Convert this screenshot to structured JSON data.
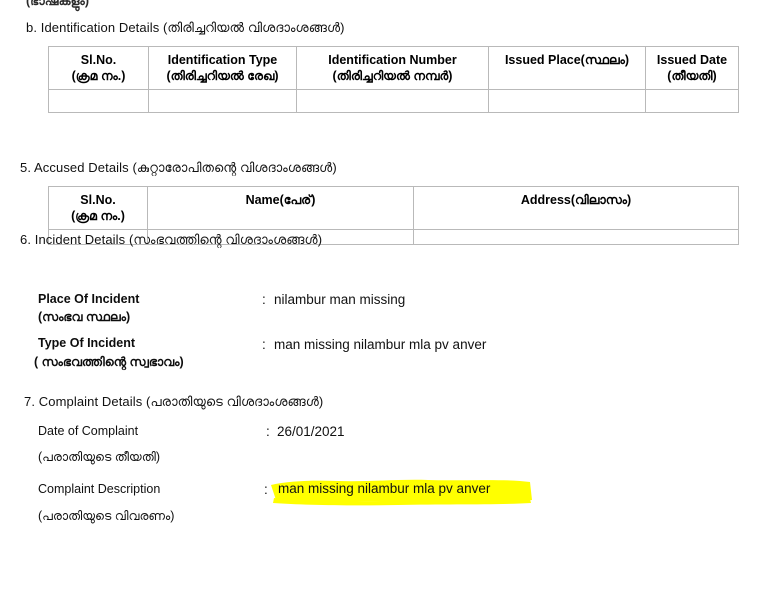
{
  "document": {
    "cut_off_top_line": "(ഭാഷകളും)",
    "colors": {
      "highlight": "#FFFF00",
      "text": "#111111",
      "table_border": "#b9b9b9",
      "page_background": "#FFFFFF"
    }
  },
  "section_b": {
    "heading": "b. Identification Details (തിരിച്ചറിയൽ വിശദാംശങ്ങൾ)",
    "table": {
      "headers": [
        {
          "en": "Sl.No.",
          "ml": "(ക്രമ നം.)"
        },
        {
          "en": "Identification Type",
          "ml": "(തിരിച്ചറിയൽ രേഖ)"
        },
        {
          "en": "Identification Number",
          "ml": "(തിരിച്ചറിയൽ നമ്പർ)"
        },
        {
          "en": "Issued Place(സ്ഥലം)",
          "ml": ""
        },
        {
          "en": "Issued Date",
          "ml": "(തീയതി)"
        }
      ],
      "rows": [
        [
          "",
          "",
          "",
          "",
          ""
        ]
      ]
    }
  },
  "section_5": {
    "heading": "5. Accused Details (കുറ്റാരോപിതന്റെ വിശദാംശങ്ങൾ)",
    "table": {
      "headers": [
        {
          "en": "Sl.No.",
          "ml": "(ക്രമ നം.)"
        },
        {
          "en": "Name(പേര്)",
          "ml": ""
        },
        {
          "en": "Address(വിലാസം)",
          "ml": ""
        }
      ],
      "rows": [
        [
          "",
          "",
          ""
        ]
      ]
    }
  },
  "section_6": {
    "heading": "6. Incident Details (സംഭവത്തിന്റെ വിശദാംശങ്ങൾ)",
    "fields": [
      {
        "label_en": "Place Of Incident",
        "label_ml": "(സംഭവ സ്ഥലം)",
        "separator": ":",
        "value": "nilambur man missing"
      },
      {
        "label_en": "Type Of Incident",
        "label_ml": "( സംഭവത്തിന്റെ സ്വഭാവം)",
        "separator": ":",
        "value": "man missing nilambur mla pv anver"
      }
    ]
  },
  "section_7": {
    "heading": "7. Complaint Details (പരാതിയുടെ വിശദാംശങ്ങൾ)",
    "fields": [
      {
        "label_en": "Date of Complaint",
        "label_ml": "(പരാതിയുടെ തീയതി)",
        "separator": ":",
        "value": "26/01/2021",
        "highlighted": false
      },
      {
        "label_en": "Complaint Description",
        "label_ml": "(പരാതിയുടെ വിവരണം)",
        "separator": ":",
        "value": "man missing nilambur mla pv anver",
        "highlighted": true
      }
    ]
  }
}
